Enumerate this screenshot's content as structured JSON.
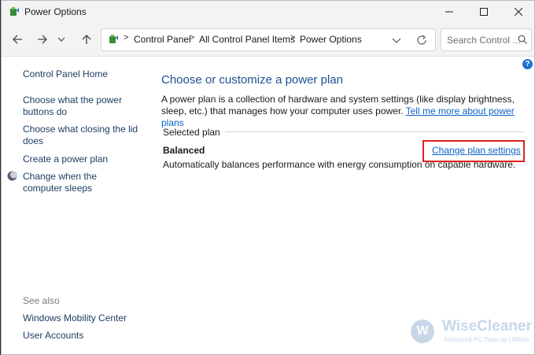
{
  "window": {
    "title": "Power Options",
    "icon": "power-options-icon"
  },
  "titlebar_buttons": {
    "minimize_icon": "minimize-icon",
    "maximize_icon": "maximize-icon",
    "close_icon": "close-icon"
  },
  "navbar": {
    "back_icon": "arrow-left-icon",
    "forward_icon": "arrow-right-icon",
    "recent_icon": "chevron-down-icon",
    "up_icon": "arrow-up-icon",
    "breadcrumbs": [
      "Control Panel",
      "All Control Panel Items",
      "Power Options"
    ],
    "breadcrumb_separator": ">",
    "refresh_icon": "refresh-icon",
    "search_placeholder": "Search Control ...",
    "search_icon": "search-icon"
  },
  "left_pane": {
    "home_link": "Control Panel Home",
    "links": [
      "Choose what the power buttons do",
      "Choose what closing the lid does",
      "Create a power plan",
      "Change when the computer sleeps"
    ],
    "see_also_label": "See also",
    "see_also_links": [
      "Windows Mobility Center",
      "User Accounts"
    ]
  },
  "main": {
    "title": "Choose or customize a power plan",
    "description": "A power plan is a collection of hardware and system settings (like display brightness, sleep, etc.) that manages how your computer uses power.",
    "learn_more_link": "Tell me more about power plans",
    "section_label": "Selected plan",
    "plan": {
      "name": "Balanced",
      "description": "Automatically balances performance with energy consumption on capable hardware.",
      "change_link": "Change plan settings"
    },
    "help_glyph": "?"
  },
  "watermark": {
    "name": "WiseCleaner",
    "tagline": "Advanced PC Tune-up Utilities",
    "logo_letter": "W"
  },
  "colors": {
    "heading": "#1e4f91",
    "link": "#0b63c5",
    "nav_link": "#1e3e63",
    "highlight": "#e02020"
  }
}
